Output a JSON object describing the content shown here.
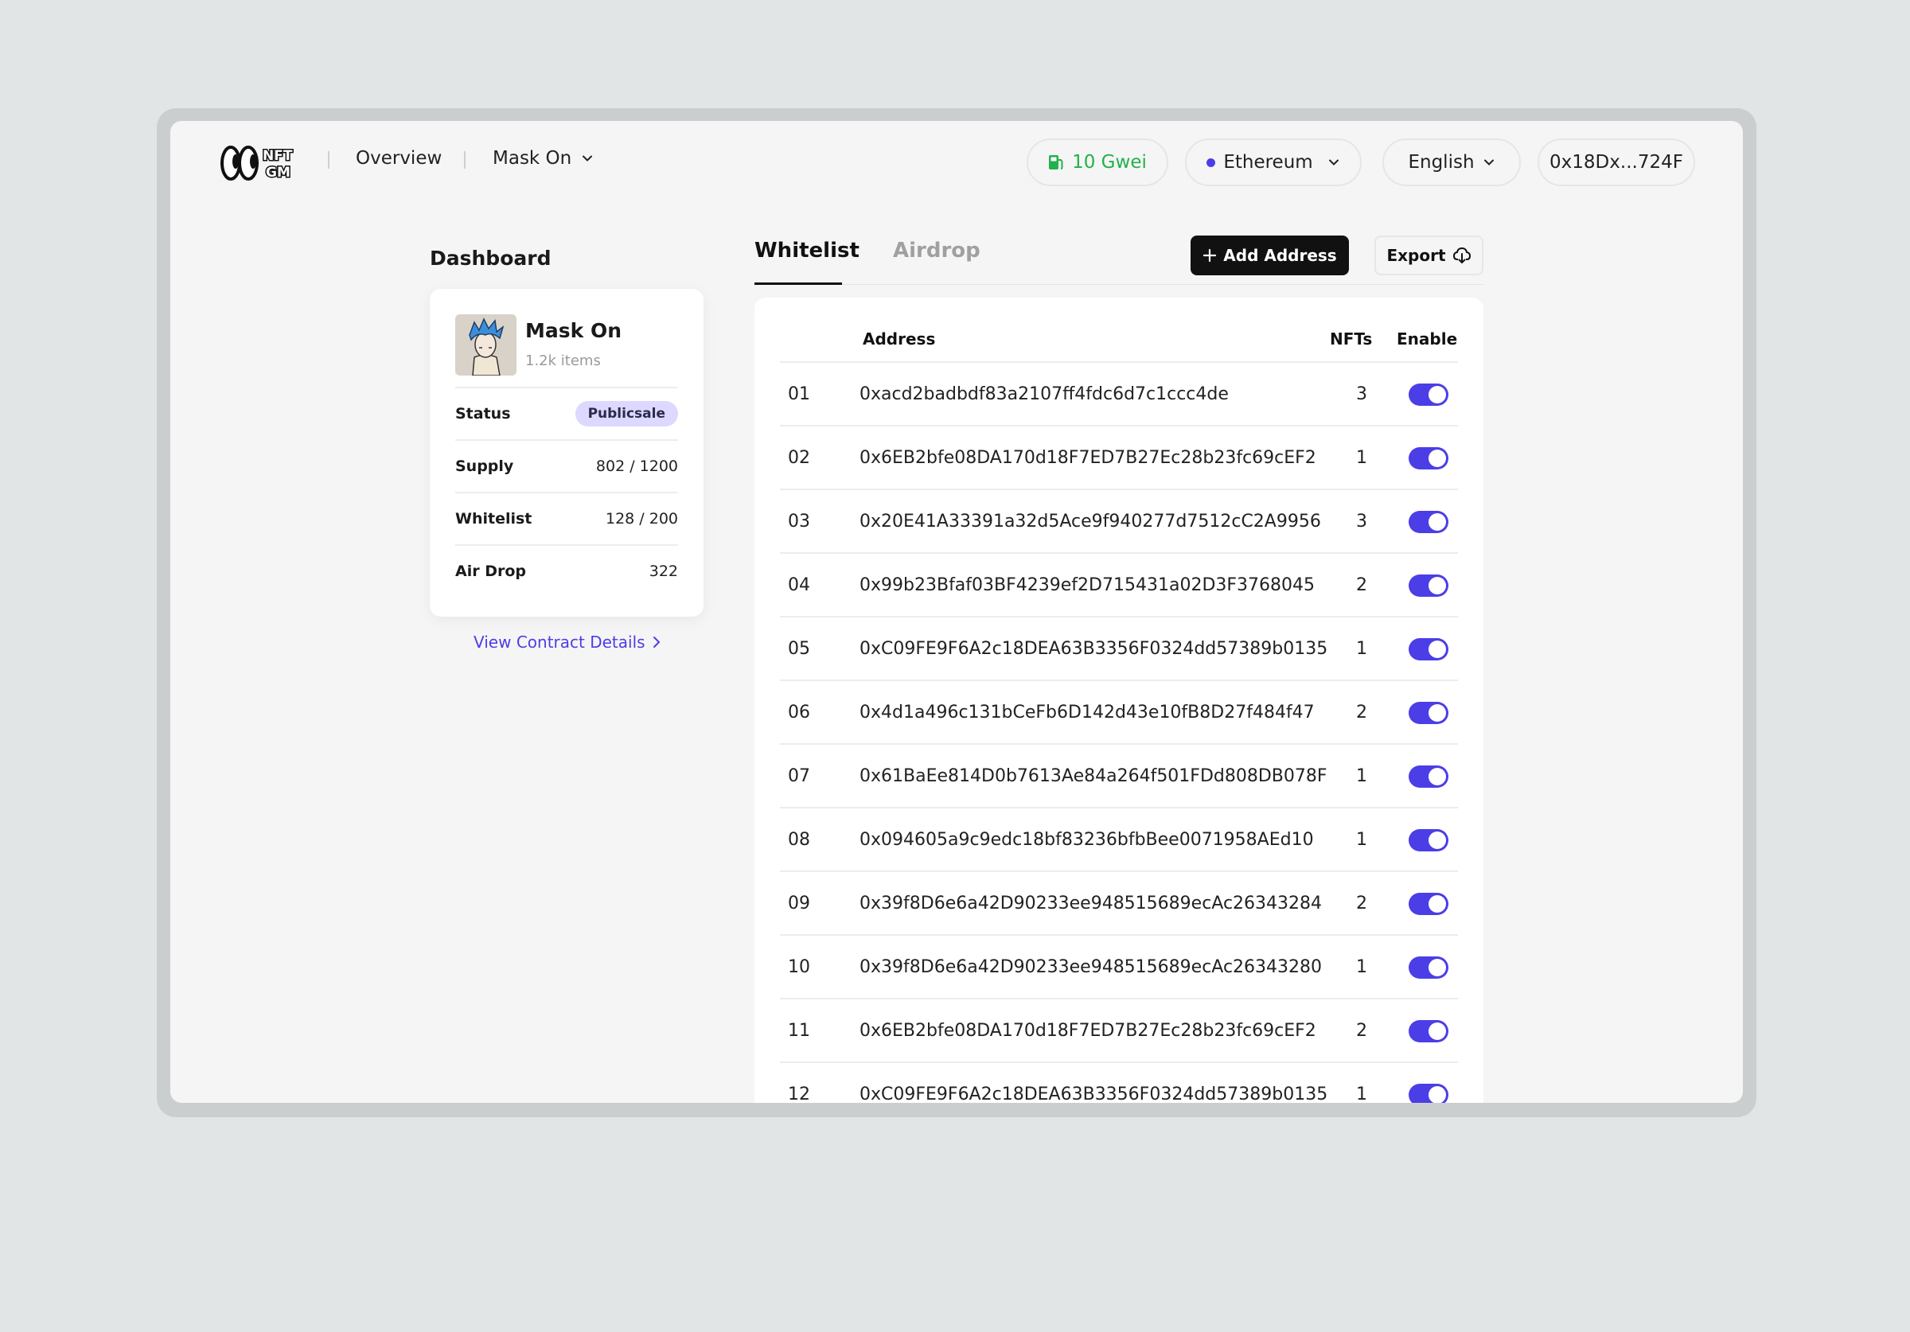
{
  "header": {
    "logo_text_top": "NFT",
    "logo_text_bottom": "GM",
    "nav_overview": "Overview",
    "nav_collection": "Mask On",
    "gas_label": "10 Gwei",
    "network_label": "Ethereum",
    "language_label": "English",
    "wallet_label": "0x18Dx...724F"
  },
  "dashboard": {
    "title": "Dashboard",
    "collection_name": "Mask On",
    "collection_items": "1.2k items",
    "status_label": "Status",
    "status_value": "Publicsale",
    "supply_label": "Supply",
    "supply_value": "802 / 1200",
    "whitelist_label": "Whitelist",
    "whitelist_value": "128 / 200",
    "airdrop_label": "Air Drop",
    "airdrop_value": "322",
    "contract_link": "View Contract Details"
  },
  "tabs": {
    "whitelist": "Whitelist",
    "airdrop": "Airdrop"
  },
  "actions": {
    "add_address": "Add Address",
    "export": "Export"
  },
  "table": {
    "col_address": "Address",
    "col_nfts": "NFTs",
    "col_enable": "Enable",
    "rows": [
      {
        "num": "01",
        "address": "0xacd2badbdf83a2107ff4fdc6d7c1ccc4de",
        "nfts": "3",
        "enabled": true
      },
      {
        "num": "02",
        "address": "0x6EB2bfe08DA170d18F7ED7B27Ec28b23fc69cEF2",
        "nfts": "1",
        "enabled": true
      },
      {
        "num": "03",
        "address": "0x20E41A33391a32d5Ace9f940277d7512cC2A9956",
        "nfts": "3",
        "enabled": true
      },
      {
        "num": "04",
        "address": "0x99b23Bfaf03BF4239ef2D715431a02D3F3768045",
        "nfts": "2",
        "enabled": true
      },
      {
        "num": "05",
        "address": "0xC09FE9F6A2c18DEA63B3356F0324dd57389b0135",
        "nfts": "1",
        "enabled": true
      },
      {
        "num": "06",
        "address": "0x4d1a496c131bCeFb6D142d43e10fB8D27f484f47",
        "nfts": "2",
        "enabled": true
      },
      {
        "num": "07",
        "address": "0x61BaEe814D0b7613Ae84a264f501FDd808DB078F",
        "nfts": "1",
        "enabled": true
      },
      {
        "num": "08",
        "address": "0x094605a9c9edc18bf83236bfbBee0071958AEd10",
        "nfts": "1",
        "enabled": true
      },
      {
        "num": "09",
        "address": "0x39f8D6e6a42D90233ee948515689ecAc26343284",
        "nfts": "2",
        "enabled": true
      },
      {
        "num": "10",
        "address": "0x39f8D6e6a42D90233ee948515689ecAc26343280",
        "nfts": "1",
        "enabled": true
      },
      {
        "num": "11",
        "address": "0x6EB2bfe08DA170d18F7ED7B27Ec28b23fc69cEF2",
        "nfts": "2",
        "enabled": true
      },
      {
        "num": "12",
        "address": "0xC09FE9F6A2c18DEA63B3356F0324dd57389b0135",
        "nfts": "1",
        "enabled": true
      }
    ]
  },
  "colors": {
    "accent": "#4b3ee6",
    "gas_green": "#22b14c",
    "badge_bg": "#dcd8ff"
  }
}
